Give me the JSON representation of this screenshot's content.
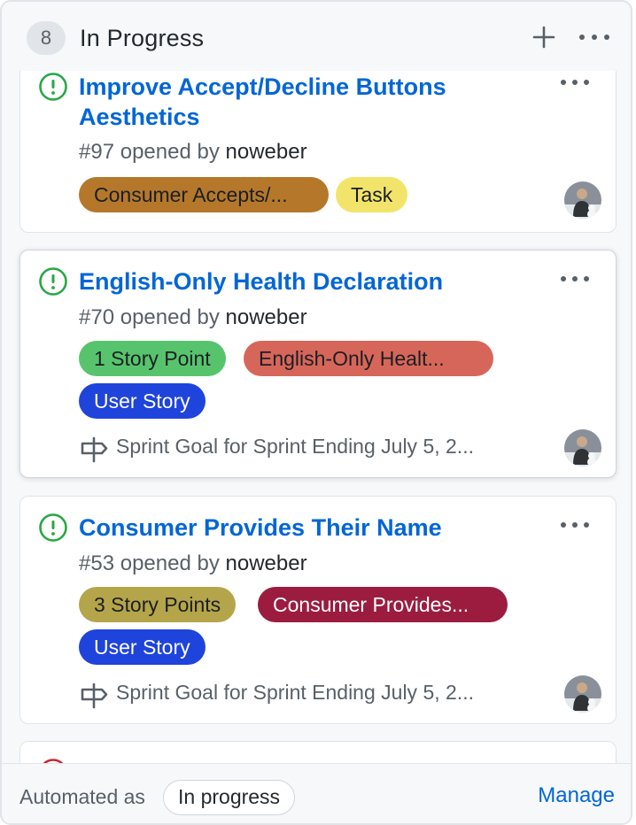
{
  "column": {
    "count": "8",
    "title": "In Progress"
  },
  "cards": [
    {
      "title": "Improve Accept/Decline Buttons Aesthetics",
      "number": "#97",
      "opened_by": "opened by",
      "author": "noweber",
      "labels": [
        {
          "text": "Consumer Accepts/...",
          "bg": "#b5782b",
          "fg": "#1b1f23"
        },
        {
          "text": "Task",
          "bg": "#f2e46a",
          "fg": "#1b1f23"
        }
      ]
    },
    {
      "title": "English-Only Health Declaration",
      "number": "#70",
      "opened_by": "opened by",
      "author": "noweber",
      "labels": [
        {
          "text": "1 Story Point",
          "bg": "#57c46d",
          "fg": "#1b1f23"
        },
        {
          "text": "English-Only Healt...",
          "bg": "#d7665a",
          "fg": "#1b1f23"
        },
        {
          "text": "User Story",
          "bg": "#1f44dc",
          "fg": "#ffffff"
        }
      ],
      "milestone": "Sprint Goal for Sprint Ending July 5, 2..."
    },
    {
      "title": "Consumer Provides Their Name",
      "number": "#53",
      "opened_by": "opened by",
      "author": "noweber",
      "labels": [
        {
          "text": "3 Story Points",
          "bg": "#b5a54a",
          "fg": "#1b1f23"
        },
        {
          "text": "Consumer Provides...",
          "bg": "#9b1c3f",
          "fg": "#ffffff"
        },
        {
          "text": "User Story",
          "bg": "#1f44dc",
          "fg": "#ffffff"
        }
      ],
      "milestone": "Sprint Goal for Sprint Ending July 5, 2..."
    }
  ],
  "footer": {
    "automated_as": "Automated as",
    "status": "In progress",
    "manage": "Manage"
  },
  "icons": {
    "issue_open": "issue-opened-icon",
    "issue_closed": "issue-closed-icon",
    "milestone": "milestone-icon",
    "more": "kebab-horizontal-icon",
    "plus": "plus-icon"
  },
  "colors": {
    "link": "#0366d6",
    "issue_open": "#28a745",
    "issue_closed": "#cb2431"
  }
}
